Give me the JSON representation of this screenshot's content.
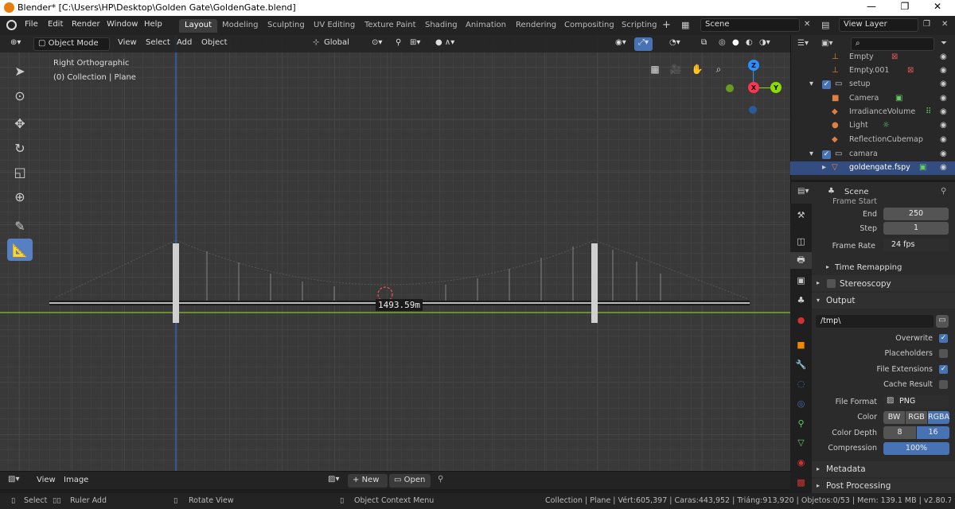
{
  "window": {
    "title": "Blender* [C:\\Users\\HP\\Desktop\\Golden Gate\\GoldenGate.blend]",
    "min": "—",
    "max": "❐",
    "close": "✕"
  },
  "menu": [
    "File",
    "Edit",
    "Render",
    "Window",
    "Help"
  ],
  "workspaces": [
    "Layout",
    "Modeling",
    "Sculpting",
    "UV Editing",
    "Texture Paint",
    "Shading",
    "Animation",
    "Rendering",
    "Compositing",
    "Scripting"
  ],
  "add_ws": "+",
  "scene": "Scene",
  "view_layer": "View Layer",
  "viewport": {
    "mode": "Object Mode",
    "menus": [
      "View",
      "Select",
      "Add",
      "Object"
    ],
    "orientation": "Global",
    "view_name": "Right Orthographic",
    "collection_info": "(0) Collection | Plane",
    "ruler_value": "1493.59m",
    "gizmo": {
      "z": "Z",
      "y": "Y",
      "x": "X"
    }
  },
  "outliner": {
    "rows": [
      {
        "label": "Empty",
        "type": "object"
      },
      {
        "label": "Empty.001",
        "type": "object"
      },
      {
        "label": "setup",
        "type": "collection"
      },
      {
        "label": "Camera",
        "type": "object"
      },
      {
        "label": "IrradianceVolume",
        "type": "object"
      },
      {
        "label": "Light",
        "type": "object"
      },
      {
        "label": "ReflectionCubemap",
        "type": "object"
      },
      {
        "label": "camara",
        "type": "collection"
      },
      {
        "label": "goldengate.fspy",
        "type": "object",
        "selected": true
      }
    ]
  },
  "properties": {
    "context": "Scene",
    "frame_start_partial": "Frame Start",
    "end_label": "End",
    "end": "250",
    "step_label": "Step",
    "step": "1",
    "frame_rate_label": "Frame Rate",
    "frame_rate": "24 fps",
    "time_remapping": "Time Remapping",
    "stereoscopy": "Stereoscopy",
    "output": "Output",
    "path": "/tmp\\",
    "overwrite": "Overwrite",
    "placeholders": "Placeholders",
    "file_extensions": "File Extensions",
    "cache_result": "Cache Result",
    "file_format_label": "File Format",
    "file_format": "PNG",
    "color_label": "Color",
    "color_opts": [
      "BW",
      "RGB",
      "RGBA"
    ],
    "color_depth_label": "Color Depth",
    "depth_opts": [
      "8",
      "16"
    ],
    "compression_label": "Compression",
    "compression": "100%",
    "metadata": "Metadata",
    "post_processing": "Post Processing"
  },
  "image_editor": {
    "menus": [
      "View",
      "Image"
    ],
    "new": "New",
    "open": "Open"
  },
  "status": {
    "select": "Select",
    "ruler_add": "Ruler Add",
    "rotate_view": "Rotate View",
    "context_menu": "Object Context Menu",
    "stats": "Collection | Plane | Vért:605,397 | Caras:443,952 | Triáng:913,920 | Objetos:0/53 | Mem: 139.1 MB | v2.80.75"
  },
  "colors": {
    "accent": "#4772b3",
    "active_tool": "#5680c2",
    "axis_x": "#ff3352",
    "axis_y": "#8bdc00",
    "axis_z": "#2890ff"
  }
}
